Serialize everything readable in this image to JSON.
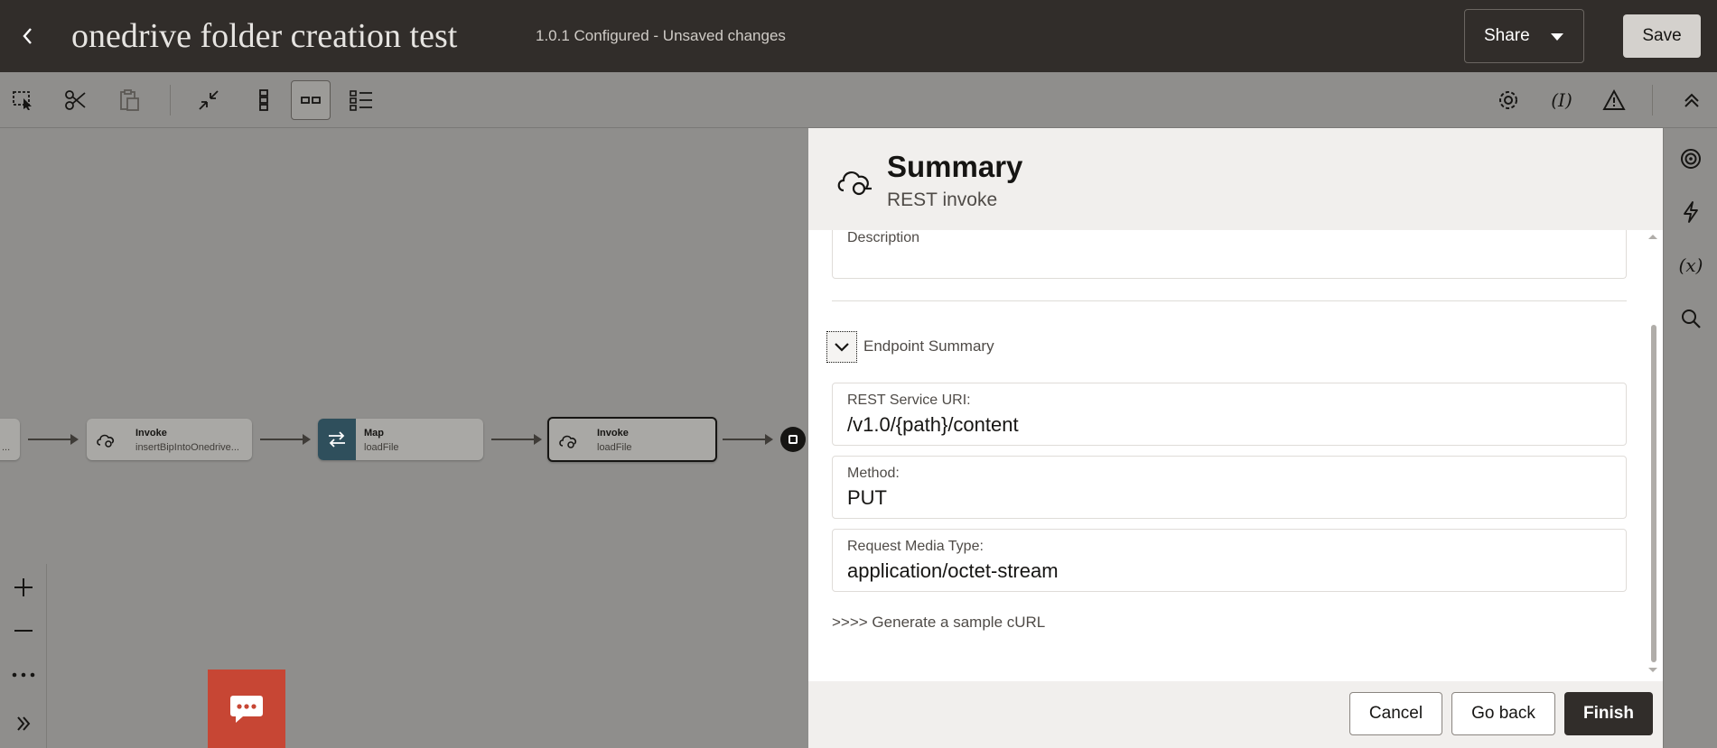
{
  "header": {
    "title": "onedrive folder creation test",
    "subtitle": "1.0.1 Configured - Unsaved changes",
    "share_label": "Share",
    "save_label": "Save"
  },
  "toolbar": {
    "icons": [
      "select-icon",
      "cut-icon",
      "paste-icon",
      "collapse-icon",
      "vertical-layout-icon",
      "horizontal-layout-icon",
      "pseudo-view-icon",
      "settings-icon",
      "tracking-icon",
      "warning-icon",
      "expand-up-icon"
    ],
    "tracking_label": "(I)"
  },
  "canvas": {
    "partial_node_text": "...",
    "nodes": [
      {
        "label": "Invoke",
        "sub": "insertBipIntoOnedrive..."
      },
      {
        "label": "Map",
        "sub": "loadFile"
      },
      {
        "label": "Invoke",
        "sub": "loadFile"
      }
    ]
  },
  "drawer": {
    "title": "Summary",
    "subtitle": "REST invoke",
    "description_label": "Description",
    "section_label": "Endpoint Summary",
    "fields": [
      {
        "label": "REST Service URI:",
        "value": "/v1.0/{path}/content"
      },
      {
        "label": "Method:",
        "value": "PUT"
      },
      {
        "label": "Request Media Type:",
        "value": "application/octet-stream"
      }
    ],
    "curl_link": ">>>> Generate a sample cURL",
    "buttons": {
      "cancel": "Cancel",
      "go_back": "Go back",
      "finish": "Finish"
    }
  },
  "rail": {
    "variables_label": "(x)"
  },
  "colors": {
    "header_bg": "#312d2a",
    "chat_fab": "#c74634",
    "map_tile": "#2f4f5c",
    "primary_button": "#312d2a"
  }
}
